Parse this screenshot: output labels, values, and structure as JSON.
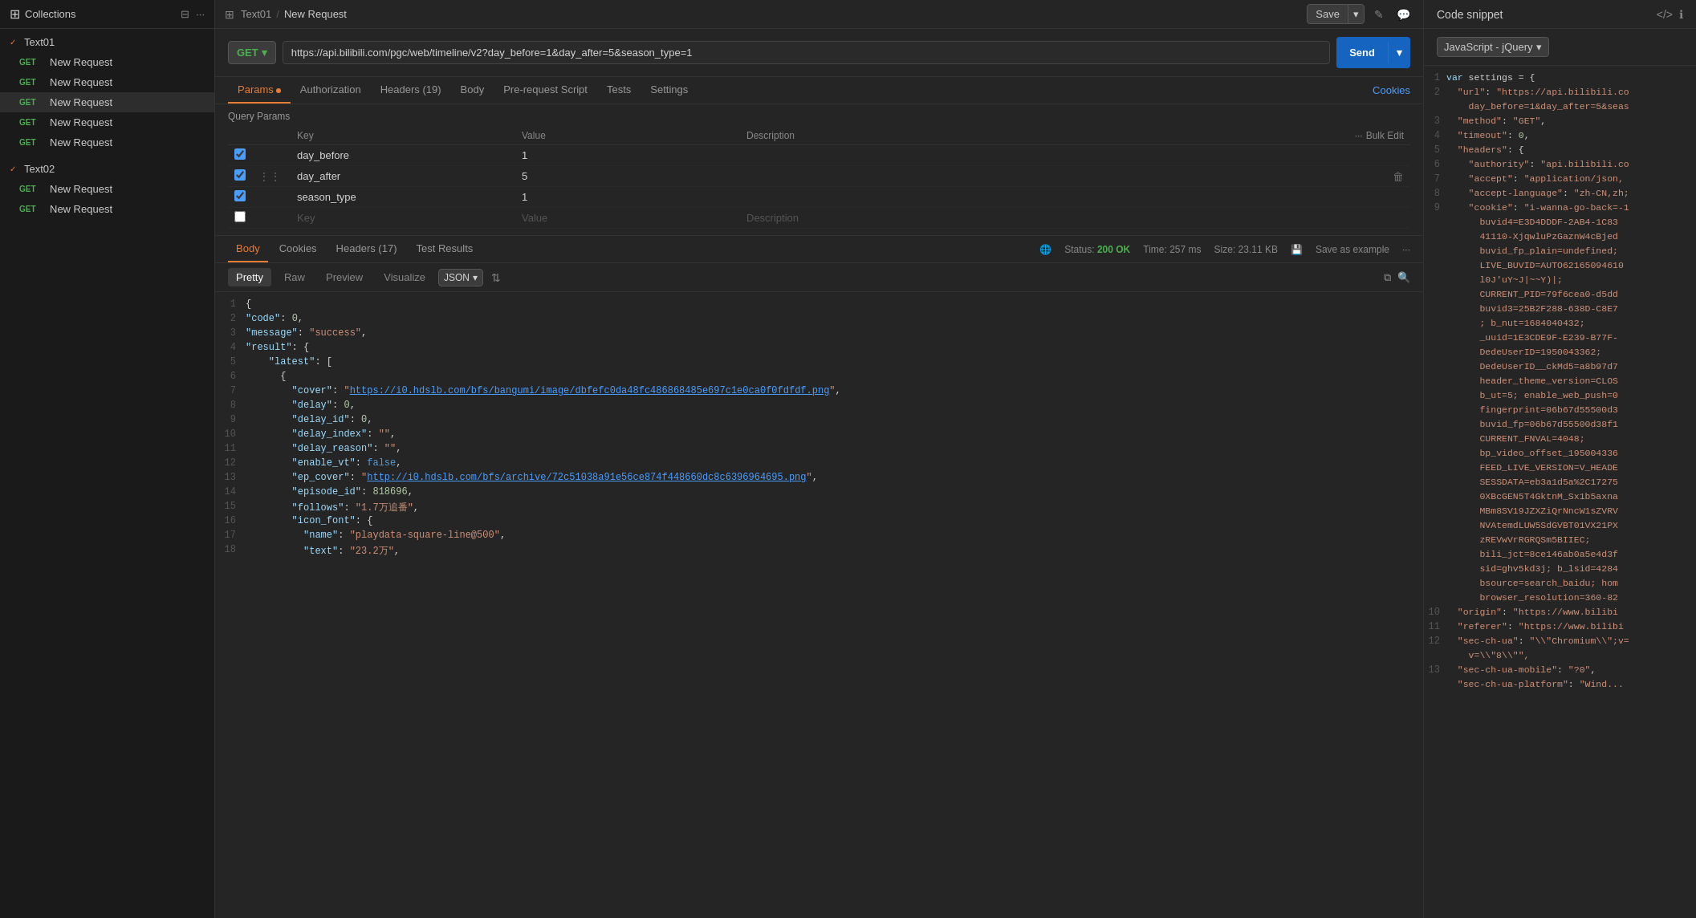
{
  "sidebar": {
    "header": {
      "title": "Collections",
      "icons": [
        "filter-icon",
        "more-icon"
      ]
    },
    "groups": [
      {
        "name": "Text01",
        "checked": true,
        "items": [
          {
            "method": "GET",
            "label": "New Request",
            "active": false
          },
          {
            "method": "GET",
            "label": "New Request",
            "active": false
          },
          {
            "method": "GET",
            "label": "New Request",
            "active": true
          },
          {
            "method": "GET",
            "label": "New Request",
            "active": false
          },
          {
            "method": "GET",
            "label": "New Request",
            "active": false
          }
        ]
      },
      {
        "name": "Text02",
        "checked": true,
        "items": [
          {
            "method": "GET",
            "label": "New Request",
            "active": false
          },
          {
            "method": "GET",
            "label": "New Request",
            "active": false
          }
        ]
      }
    ]
  },
  "topbar": {
    "breadcrumb_collection": "Text01",
    "breadcrumb_request": "New Request",
    "save_label": "Save",
    "arrow": "▾"
  },
  "request": {
    "method": "GET",
    "url": "https://api.bilibili.com/pgc/web/timeline/v2?day_before=1&day_after=5&season_type=1",
    "send_label": "Send"
  },
  "request_tabs": [
    {
      "label": "Params",
      "active": true,
      "dot": true
    },
    {
      "label": "Authorization",
      "active": false,
      "dot": false
    },
    {
      "label": "Headers (19)",
      "active": false,
      "dot": false
    },
    {
      "label": "Body",
      "active": false,
      "dot": false
    },
    {
      "label": "Pre-request Script",
      "active": false,
      "dot": false
    },
    {
      "label": "Tests",
      "active": false,
      "dot": false
    },
    {
      "label": "Settings",
      "active": false,
      "dot": false
    }
  ],
  "cookies_label": "Cookies",
  "query_params": {
    "title": "Query Params",
    "columns": {
      "key": "Key",
      "value": "Value",
      "description": "Description",
      "bulk_edit": "Bulk Edit"
    },
    "rows": [
      {
        "checked": true,
        "key": "day_before",
        "value": "1",
        "description": ""
      },
      {
        "checked": true,
        "key": "day_after",
        "value": "5",
        "description": ""
      },
      {
        "checked": true,
        "key": "season_type",
        "value": "1",
        "description": ""
      },
      {
        "checked": false,
        "key": "",
        "value": "",
        "description": ""
      }
    ]
  },
  "response": {
    "tabs": [
      {
        "label": "Body",
        "active": true
      },
      {
        "label": "Cookies",
        "active": false
      },
      {
        "label": "Headers (17)",
        "active": false
      },
      {
        "label": "Test Results",
        "active": false
      }
    ],
    "status": "200 OK",
    "time": "257 ms",
    "size": "23.11 KB",
    "save_example": "Save as example",
    "formats": [
      {
        "label": "Pretty",
        "active": true
      },
      {
        "label": "Raw",
        "active": false
      },
      {
        "label": "Preview",
        "active": false
      },
      {
        "label": "Visualize",
        "active": false
      }
    ],
    "format_type": "JSON",
    "lines": [
      {
        "num": 1,
        "content": "{",
        "type": "bracket"
      },
      {
        "num": 2,
        "content": "  \"code\": 0,",
        "type": "mixed"
      },
      {
        "num": 3,
        "content": "  \"message\": \"success\",",
        "type": "mixed"
      },
      {
        "num": 4,
        "content": "  \"result\": {",
        "type": "mixed"
      },
      {
        "num": 5,
        "content": "    \"latest\": [",
        "type": "mixed"
      },
      {
        "num": 6,
        "content": "      {",
        "type": "bracket"
      },
      {
        "num": 7,
        "content": "        \"cover\": \"https://i0.hdslb.com/bfs/bangumi/image/dbfefc0da48fc486868485e697c1e0ca0f0fdfdf.png\",",
        "type": "link-line",
        "pre": "        \"cover\": \"",
        "link": "https://i0.hdslb.com/bfs/bangumi/image/dbfefc0da48fc486868485e697c1e0ca0f0fdfdf.png",
        "post": "\","
      },
      {
        "num": 8,
        "content": "        \"delay\": 0,",
        "type": "mixed"
      },
      {
        "num": 9,
        "content": "        \"delay_id\": 0,",
        "type": "mixed"
      },
      {
        "num": 10,
        "content": "        \"delay_index\": \"\",",
        "type": "mixed"
      },
      {
        "num": 11,
        "content": "        \"delay_reason\": \"\",",
        "type": "mixed"
      },
      {
        "num": 12,
        "content": "        \"enable_vt\": false,",
        "type": "bool-line"
      },
      {
        "num": 13,
        "content": "        \"ep_cover\": \"http://i0.hdslb.com/bfs/archive/72c51038a91e56ce874f448660dc8c6396964695.png\",",
        "type": "link-line2",
        "pre": "        \"ep_cover\": \"",
        "link": "http://i0.hdslb.com/bfs/archive/72c51038a91e56ce874f448660dc8c6396964695.png",
        "post": "\","
      },
      {
        "num": 14,
        "content": "        \"episode_id\": 818696,",
        "type": "mixed"
      },
      {
        "num": 15,
        "content": "        \"follows\": \"1.7万追番\",",
        "type": "mixed"
      },
      {
        "num": 16,
        "content": "        \"icon_font\": {",
        "type": "mixed"
      },
      {
        "num": 17,
        "content": "          \"name\": \"playdata-square-line@500\",",
        "type": "mixed"
      },
      {
        "num": 18,
        "content": "          \"text\": \"23.2万\",",
        "type": "mixed"
      }
    ]
  },
  "code_snippet": {
    "title": "Code snippet",
    "language": "JavaScript - jQuery",
    "lines": [
      {
        "num": 1,
        "content": "var settings = {"
      },
      {
        "num": 2,
        "content": "  \"url\": \"https://api.bilibili.co",
        "suffix": "day_before=1&day_after=5&seas"
      },
      {
        "num": 3,
        "content": "  \"method\": \"GET\","
      },
      {
        "num": 4,
        "content": "  \"timeout\": 0,"
      },
      {
        "num": 5,
        "content": "  \"headers\": {"
      },
      {
        "num": 6,
        "content": "    \"authority\": \"api.bilibili.co"
      },
      {
        "num": 7,
        "content": "    \"accept\": \"application/json,"
      },
      {
        "num": 8,
        "content": "    \"accept-language\": \"zh-CN,zh;"
      },
      {
        "num": 9,
        "content": "    \"cookie\": \"i-wanna-go-back=-1"
      },
      {
        "num": 9,
        "content": "      buvid4=E3D4DDDF-2AB4-1C83"
      },
      {
        "num": 9,
        "content": "      41110-XjqwluPzGaznW4cBjed"
      },
      {
        "num": 9,
        "content": "      buvid_fp_plain=undefined;"
      },
      {
        "num": 9,
        "content": "      LIVE_BUVID=AUTO62165094610"
      },
      {
        "num": 9,
        "content": "      l0J'uY~J|~~Y)|;"
      },
      {
        "num": 9,
        "content": "      CURRENT_PID=79f6cea0-d5dd"
      },
      {
        "num": 9,
        "content": "      buvid3=25B2F288-638D-C8E7"
      },
      {
        "num": 9,
        "content": "      ; b_nut=1684040432;"
      },
      {
        "num": 9,
        "content": "      _uuid=1E3CDE9F-E239-B77F-"
      },
      {
        "num": 9,
        "content": "      DedeUserID=1950043362;"
      },
      {
        "num": 9,
        "content": "      DedeUserID__ckMd5=a8b97d7"
      },
      {
        "num": 9,
        "content": "      header_theme_version=CLOS"
      },
      {
        "num": 9,
        "content": "      b_ut=5; enable_web_push=0"
      },
      {
        "num": 9,
        "content": "      fingerprint=06b67d55500d3"
      },
      {
        "num": 9,
        "content": "      buvid_fp=06b67d55500d38f1"
      },
      {
        "num": 9,
        "content": "      CURRENT_FNVAL=4048;"
      },
      {
        "num": 9,
        "content": "      bp_video_offset_195004336"
      },
      {
        "num": 9,
        "content": "      FEED_LIVE_VERSION=V_HEADE"
      },
      {
        "num": 9,
        "content": "      SESSDATA=eb3a1d5a%2C17275"
      },
      {
        "num": 9,
        "content": "      0XBcGEN5T4GktnM_Sx1b5axna"
      },
      {
        "num": 9,
        "content": "      MBm8SV19JZXZiQrNncW1sZVRV"
      },
      {
        "num": 9,
        "content": "      NVAtemdLUW5SdGVBT01VX21PX"
      },
      {
        "num": 9,
        "content": "      zREVwVrRGRQSm5BIIEC;"
      },
      {
        "num": 9,
        "content": "      bili_jct=8ce146ab0a5e4d3f"
      },
      {
        "num": 9,
        "content": "      sid=ghv5kd3j; b_lsid=4284"
      },
      {
        "num": 9,
        "content": "      bsource=search_baidu; hom"
      },
      {
        "num": 9,
        "content": "      browser_resolution=360-82"
      },
      {
        "num": 10,
        "content": "  \"origin\": \"https://www.bilibi"
      },
      {
        "num": 11,
        "content": "  \"referer\": \"https://www.bilibi"
      },
      {
        "num": 12,
        "content": "  \"sec-ch-ua\": \"\\\"Chromium\\\";v="
      },
      {
        "num": 12,
        "content": "    v=\\\"8\\\"\","
      },
      {
        "num": 13,
        "content": "  \"sec-ch-ua-mobile\": \"?0\","
      },
      {
        "num": 13,
        "content": "  \"sec-ch-ua-platform\": \"Wind..."
      }
    ]
  }
}
